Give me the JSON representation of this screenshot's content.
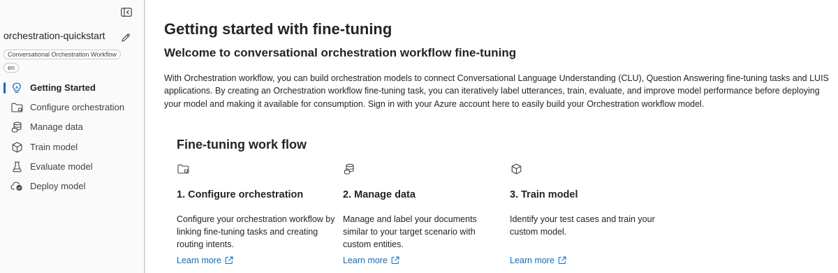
{
  "project": {
    "name": "orchestration-quickstart",
    "type_tag": "Conversational Orchestration Workflow",
    "language_tag": "en"
  },
  "sidebar": {
    "items": [
      {
        "label": "Getting Started",
        "icon": "lightbulb-icon",
        "active": true
      },
      {
        "label": "Configure orchestration",
        "icon": "folder-icon",
        "active": false
      },
      {
        "label": "Manage data",
        "icon": "database-icon",
        "active": false
      },
      {
        "label": "Train model",
        "icon": "cube-icon",
        "active": false
      },
      {
        "label": "Evaluate model",
        "icon": "beaker-icon",
        "active": false
      },
      {
        "label": "Deploy model",
        "icon": "cloud-icon",
        "active": false
      }
    ]
  },
  "main": {
    "title": "Getting started with fine-tuning",
    "subtitle": "Welcome to conversational orchestration workflow fine-tuning",
    "intro": "With Orchestration workflow, you can build orchestration models to connect Conversational Language Understanding (CLU), Question Answering fine-tuning tasks and LUIS applications. By creating an Orchestration workflow fine-tuning task, you can iteratively label utterances, train, evaluate, and improve model performance before deploying your model and making it available for consumption. Sign in with your Azure account here to easily build your Orchestration workflow model.",
    "workflow_title": "Fine-tuning work flow",
    "cards": [
      {
        "icon": "folder-icon",
        "title": "1. Configure orchestration",
        "description": "Configure your orchestration workflow by linking fine-tuning tasks and creating routing intents.",
        "link": "Learn more"
      },
      {
        "icon": "database-icon",
        "title": "2. Manage data",
        "description": "Manage and label your documents similar to your target scenario with custom entities.",
        "link": "Learn more"
      },
      {
        "icon": "cube-icon",
        "title": "3. Train model",
        "description": "Identify your test cases and train your custom model.",
        "link": "Learn more"
      }
    ]
  },
  "colors": {
    "accent": "#0f6cbd",
    "sidebar_bg": "#fafafa",
    "divider": "#d6d6d6",
    "text": "#242424"
  }
}
